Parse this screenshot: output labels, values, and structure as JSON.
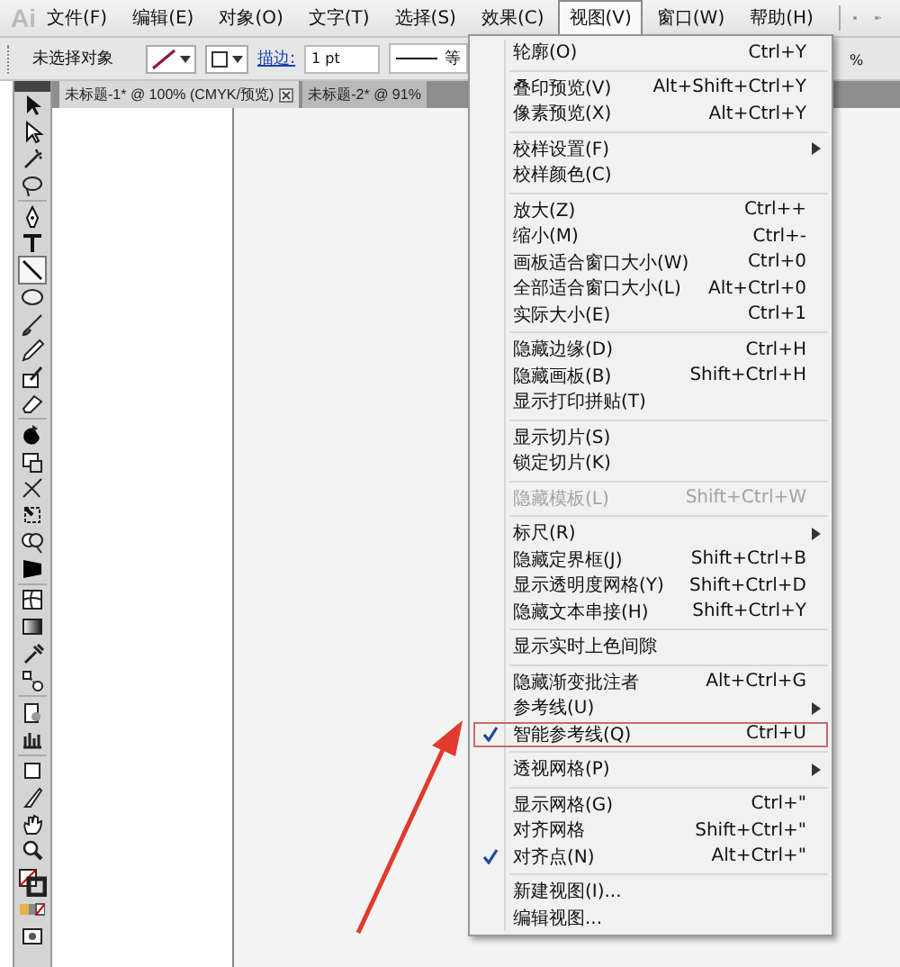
{
  "app_logo": "Ai",
  "menubar": [
    {
      "label": "文件(F)",
      "selected": false
    },
    {
      "label": "编辑(E)",
      "selected": false
    },
    {
      "label": "对象(O)",
      "selected": false
    },
    {
      "label": "文字(T)",
      "selected": false
    },
    {
      "label": "选择(S)",
      "selected": false
    },
    {
      "label": "效果(C)",
      "selected": false
    },
    {
      "label": "视图(V)",
      "selected": true
    },
    {
      "label": "窗口(W)",
      "selected": false
    },
    {
      "label": "帮助(H)",
      "selected": false
    }
  ],
  "options_bar": {
    "selection": "未选择对象",
    "stroke_label": "描边:",
    "stroke_weight": "1 pt",
    "profile_label": "等",
    "opacity_suffix": "%"
  },
  "tabs": [
    {
      "label": "未标题-1* @ 100% (CMYK/预览)",
      "selected": true
    },
    {
      "label": "未标题-2* @ 91%",
      "selected": false
    }
  ],
  "view_menu": {
    "groups": [
      [
        {
          "label": "轮廓(O)",
          "shortcut": "Ctrl+Y",
          "kind": "item",
          "checked": false,
          "disabled": false,
          "highlighted": false
        }
      ],
      [
        {
          "label": "叠印预览(V)",
          "shortcut": "Alt+Shift+Ctrl+Y",
          "kind": "item",
          "checked": false,
          "disabled": false,
          "highlighted": false
        },
        {
          "label": "像素预览(X)",
          "shortcut": "Alt+Ctrl+Y",
          "kind": "item",
          "checked": false,
          "disabled": false,
          "highlighted": false
        }
      ],
      [
        {
          "label": "校样设置(F)",
          "kind": "submenu",
          "checked": false,
          "disabled": false,
          "highlighted": false
        },
        {
          "label": "校样颜色(C)",
          "kind": "item",
          "checked": false,
          "disabled": false,
          "highlighted": false
        }
      ],
      [
        {
          "label": "放大(Z)",
          "shortcut": "Ctrl++",
          "kind": "item",
          "checked": false,
          "disabled": false,
          "highlighted": false
        },
        {
          "label": "缩小(M)",
          "shortcut": "Ctrl+-",
          "kind": "item",
          "checked": false,
          "disabled": false,
          "highlighted": false
        },
        {
          "label": "画板适合窗口大小(W)",
          "shortcut": "Ctrl+0",
          "kind": "item",
          "checked": false,
          "disabled": false,
          "highlighted": false
        },
        {
          "label": "全部适合窗口大小(L)",
          "shortcut": "Alt+Ctrl+0",
          "kind": "item",
          "checked": false,
          "disabled": false,
          "highlighted": false
        },
        {
          "label": "实际大小(E)",
          "shortcut": "Ctrl+1",
          "kind": "item",
          "checked": false,
          "disabled": false,
          "highlighted": false
        }
      ],
      [
        {
          "label": "隐藏边缘(D)",
          "shortcut": "Ctrl+H",
          "kind": "item",
          "checked": false,
          "disabled": false,
          "highlighted": false
        },
        {
          "label": "隐藏画板(B)",
          "shortcut": "Shift+Ctrl+H",
          "kind": "item",
          "checked": false,
          "disabled": false,
          "highlighted": false
        },
        {
          "label": "显示打印拼贴(T)",
          "kind": "item",
          "checked": false,
          "disabled": false,
          "highlighted": false
        }
      ],
      [
        {
          "label": "显示切片(S)",
          "kind": "item",
          "checked": false,
          "disabled": false,
          "highlighted": false
        },
        {
          "label": "锁定切片(K)",
          "kind": "item",
          "checked": false,
          "disabled": false,
          "highlighted": false
        }
      ],
      [
        {
          "label": "隐藏模板(L)",
          "shortcut": "Shift+Ctrl+W",
          "kind": "item",
          "checked": false,
          "disabled": true,
          "highlighted": false
        }
      ],
      [
        {
          "label": "标尺(R)",
          "kind": "submenu",
          "checked": false,
          "disabled": false,
          "highlighted": false
        },
        {
          "label": "隐藏定界框(J)",
          "shortcut": "Shift+Ctrl+B",
          "kind": "item",
          "checked": false,
          "disabled": false,
          "highlighted": false
        },
        {
          "label": "显示透明度网格(Y)",
          "shortcut": "Shift+Ctrl+D",
          "kind": "item",
          "checked": false,
          "disabled": false,
          "highlighted": false
        },
        {
          "label": "隐藏文本串接(H)",
          "shortcut": "Shift+Ctrl+Y",
          "kind": "item",
          "checked": false,
          "disabled": false,
          "highlighted": false
        }
      ],
      [
        {
          "label": "显示实时上色间隙",
          "kind": "item",
          "checked": false,
          "disabled": false,
          "highlighted": false
        }
      ],
      [
        {
          "label": "隐藏渐变批注者",
          "shortcut": "Alt+Ctrl+G",
          "kind": "item",
          "checked": false,
          "disabled": false,
          "highlighted": false
        },
        {
          "label": "参考线(U)",
          "kind": "submenu",
          "checked": false,
          "disabled": false,
          "highlighted": false
        },
        {
          "label": "智能参考线(Q)",
          "shortcut": "Ctrl+U",
          "kind": "item",
          "checked": true,
          "disabled": false,
          "highlighted": true
        }
      ],
      [
        {
          "label": "透视网格(P)",
          "kind": "submenu",
          "checked": false,
          "disabled": false,
          "highlighted": false
        }
      ],
      [
        {
          "label": "显示网格(G)",
          "shortcut": "Ctrl+\"",
          "kind": "item",
          "checked": false,
          "disabled": false,
          "highlighted": false
        },
        {
          "label": "对齐网格",
          "shortcut": "Shift+Ctrl+\"",
          "kind": "item",
          "checked": false,
          "disabled": false,
          "highlighted": false
        },
        {
          "label": "对齐点(N)",
          "shortcut": "Alt+Ctrl+\"",
          "kind": "item",
          "checked": true,
          "disabled": false,
          "highlighted": false
        }
      ],
      [
        {
          "label": "新建视图(I)...",
          "kind": "item",
          "checked": false,
          "disabled": false,
          "highlighted": false
        },
        {
          "label": "编辑视图...",
          "kind": "item",
          "checked": false,
          "disabled": false,
          "highlighted": false
        }
      ]
    ]
  }
}
